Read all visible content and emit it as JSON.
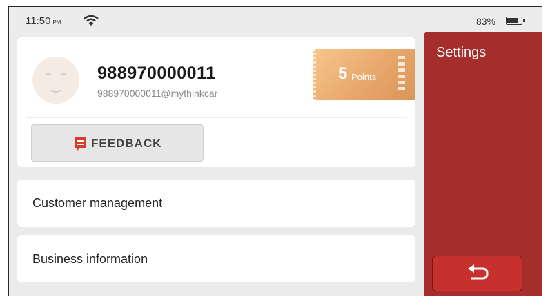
{
  "status_bar": {
    "time": "11:50",
    "ampm": "PM",
    "battery": "83%",
    "wifi_icon": "wifi-icon",
    "battery_icon": "battery-icon"
  },
  "profile": {
    "user_id": "988970000011",
    "email": "988970000011@mythinkcar",
    "points_number": "5",
    "points_label": "Points",
    "avatar_icon": "avatar-face-icon"
  },
  "feedback": {
    "label": "FEEDBACK",
    "icon": "chat-bubble-icon"
  },
  "menu": [
    {
      "label": "Customer management"
    },
    {
      "label": "Business information"
    }
  ],
  "side_panel": {
    "title": "Settings",
    "back_icon": "return-arrow-icon"
  },
  "colors": {
    "accent_red": "#a52d2c",
    "points_gold": "#e8a76b",
    "feedback_icon_red": "#d93b30"
  }
}
